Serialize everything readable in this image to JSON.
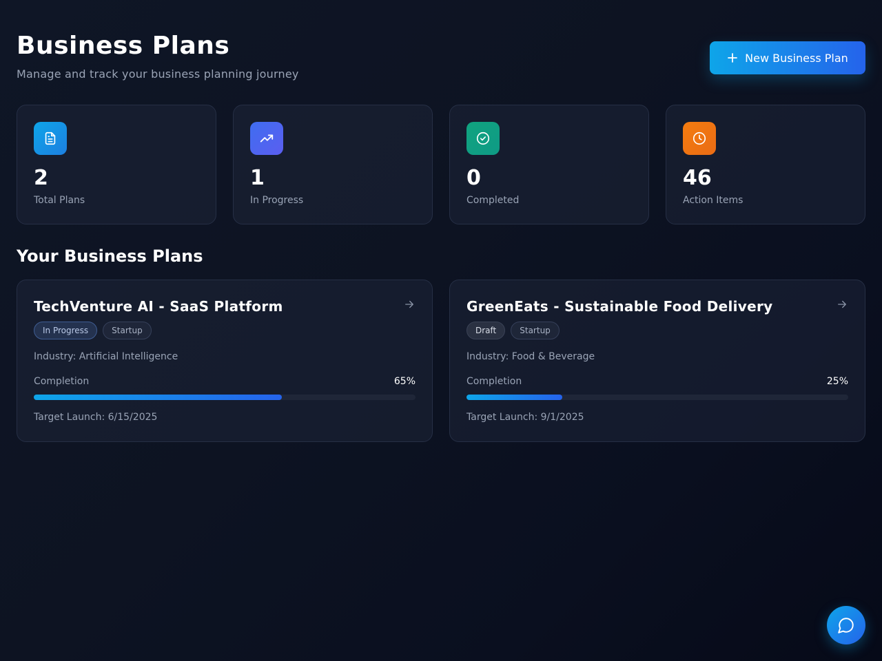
{
  "header": {
    "title": "Business Plans",
    "subtitle": "Manage and track your business planning journey",
    "new_plan_label": "New Business Plan",
    "new_plan_icon": "plus-icon"
  },
  "stats": [
    {
      "value": "2",
      "label": "Total Plans",
      "icon": "document-icon",
      "color": "#0ea5e9"
    },
    {
      "value": "1",
      "label": "In Progress",
      "icon": "trending-up-icon",
      "color": "#4f63f0"
    },
    {
      "value": "0",
      "label": "Completed",
      "icon": "check-circle-icon",
      "color": "#10a37f"
    },
    {
      "value": "46",
      "label": "Action Items",
      "icon": "clock-icon",
      "color": "#f27a12"
    }
  ],
  "section_title": "Your Business Plans",
  "plans": [
    {
      "title": "TechVenture AI - SaaS Platform",
      "status": "In Progress",
      "type": "Startup",
      "industry": "Industry: Artificial Intelligence",
      "completion_label": "Completion",
      "completion_value": "65%",
      "completion": 0.65,
      "target_launch": "Target Launch: 6/15/2025"
    },
    {
      "title": "GreenEats - Sustainable Food Delivery",
      "status": "Draft",
      "type": "Startup",
      "industry": "Industry: Food & Beverage",
      "completion_label": "Completion",
      "completion_value": "25%",
      "completion": 0.25,
      "target_launch": "Target Launch: 9/1/2025"
    }
  ],
  "colors": {
    "accent_start": "#0ea5e9",
    "accent_end": "#2563eb",
    "background": "#0d1322"
  },
  "chat_icon": "chat-bubble-icon"
}
